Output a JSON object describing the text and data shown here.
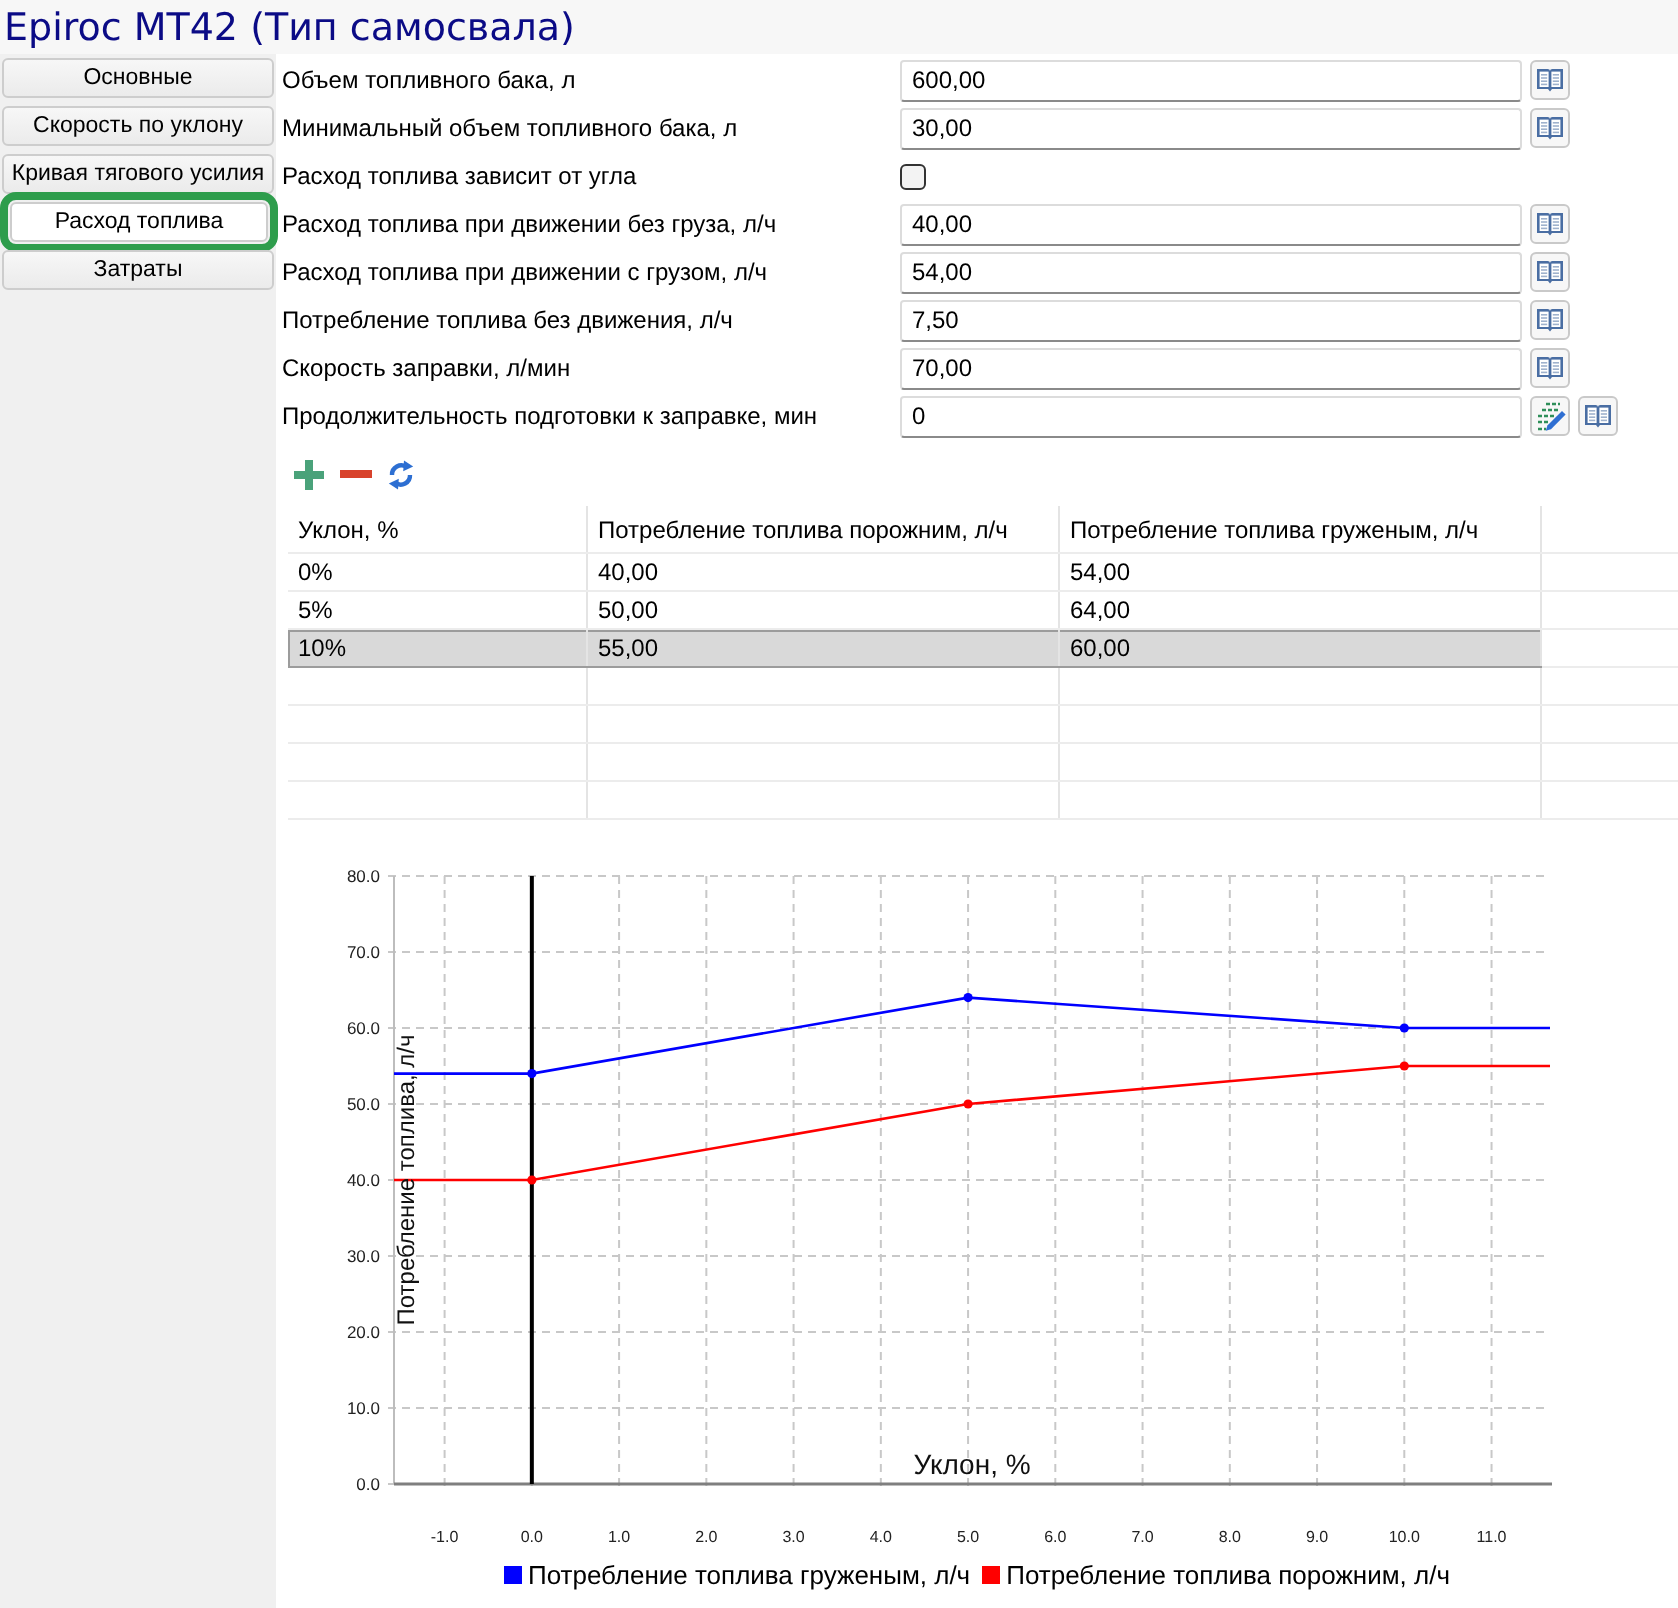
{
  "window": {
    "title": "Epiroc MT42 (Тип самосвала)"
  },
  "sidebar": {
    "items": [
      {
        "label": "Основные",
        "selected": false
      },
      {
        "label": "Скорость по уклону",
        "selected": false
      },
      {
        "label": "Кривая тягового усилия",
        "selected": false
      },
      {
        "label": "Расход топлива",
        "selected": true
      },
      {
        "label": "Затраты",
        "selected": false
      }
    ]
  },
  "form": {
    "fields": [
      {
        "kind": "field",
        "label": "Объем топливного бака, л",
        "value": "600,00"
      },
      {
        "kind": "field",
        "label": "Минимальный объем топливного бака, л",
        "value": "30,00"
      },
      {
        "kind": "checkbox",
        "label": "Расход топлива зависит от угла",
        "checked": false
      },
      {
        "kind": "field",
        "label": "Расход топлива при движении без груза, л/ч",
        "value": "40,00"
      },
      {
        "kind": "field",
        "label": "Расход топлива при движении с грузом, л/ч",
        "value": "54,00"
      },
      {
        "kind": "field",
        "label": "Потребление топлива без движения, л/ч",
        "value": "7,50"
      },
      {
        "kind": "field",
        "label": "Скорость заправки, л/мин",
        "value": "70,00"
      },
      {
        "kind": "field_editor",
        "label": "Продолжительность подготовки к заправке, мин",
        "value": "0"
      }
    ]
  },
  "table": {
    "columns": [
      "Уклон, %",
      "Потребление топлива порожним, л/ч",
      "Потребление топлива груженым, л/ч"
    ],
    "rows": [
      {
        "cells": [
          "0%",
          "40,00",
          "54,00"
        ],
        "selected": false
      },
      {
        "cells": [
          "5%",
          "50,00",
          "64,00"
        ],
        "selected": false
      },
      {
        "cells": [
          "10%",
          "55,00",
          "60,00"
        ],
        "selected": true
      }
    ]
  },
  "chart": {
    "chart_data": {
      "type": "line",
      "xlabel": "Уклон, %",
      "ylabel": "Потребление топлива, л/ч",
      "x": [
        -1.58,
        0,
        5,
        10,
        11.67
      ],
      "series": [
        {
          "name": "Потребление топлива груженым, л/ч",
          "color": "#0000ff",
          "marker": "circle",
          "values": [
            54,
            54,
            64,
            60,
            60
          ]
        },
        {
          "name": "Потребление топлива порожним, л/ч",
          "color": "#ff0000",
          "marker": "circle",
          "values": [
            40,
            40,
            50,
            55,
            55
          ]
        }
      ],
      "xlim": [
        -1.58,
        11.67
      ],
      "ylim": [
        0,
        80
      ],
      "grid": true,
      "legend": "bottom",
      "xticks": [
        {
          "value": -1,
          "label": "-1.0"
        },
        {
          "value": 0,
          "label": "0.0"
        },
        {
          "value": 1,
          "label": "1.0"
        },
        {
          "value": 2,
          "label": "2.0"
        },
        {
          "value": 3,
          "label": "3.0"
        },
        {
          "value": 4,
          "label": "4.0"
        },
        {
          "value": 5,
          "label": "5.0"
        },
        {
          "value": 6,
          "label": "6.0"
        },
        {
          "value": 7,
          "label": "7.0"
        },
        {
          "value": 8,
          "label": "8.0"
        },
        {
          "value": 9,
          "label": "9.0"
        },
        {
          "value": 10,
          "label": "10.0"
        },
        {
          "value": 11,
          "label": "11.0"
        }
      ],
      "yticks": [
        {
          "value": 0,
          "label": "0.0"
        },
        {
          "value": 10,
          "label": "10.0"
        },
        {
          "value": 20,
          "label": "20.0"
        },
        {
          "value": 30,
          "label": "30.0"
        },
        {
          "value": 40,
          "label": "40.0"
        },
        {
          "value": 50,
          "label": "50.0"
        },
        {
          "value": 60,
          "label": "60.0"
        },
        {
          "value": 70,
          "label": "70.0"
        },
        {
          "value": 80,
          "label": "80.0"
        }
      ]
    }
  }
}
